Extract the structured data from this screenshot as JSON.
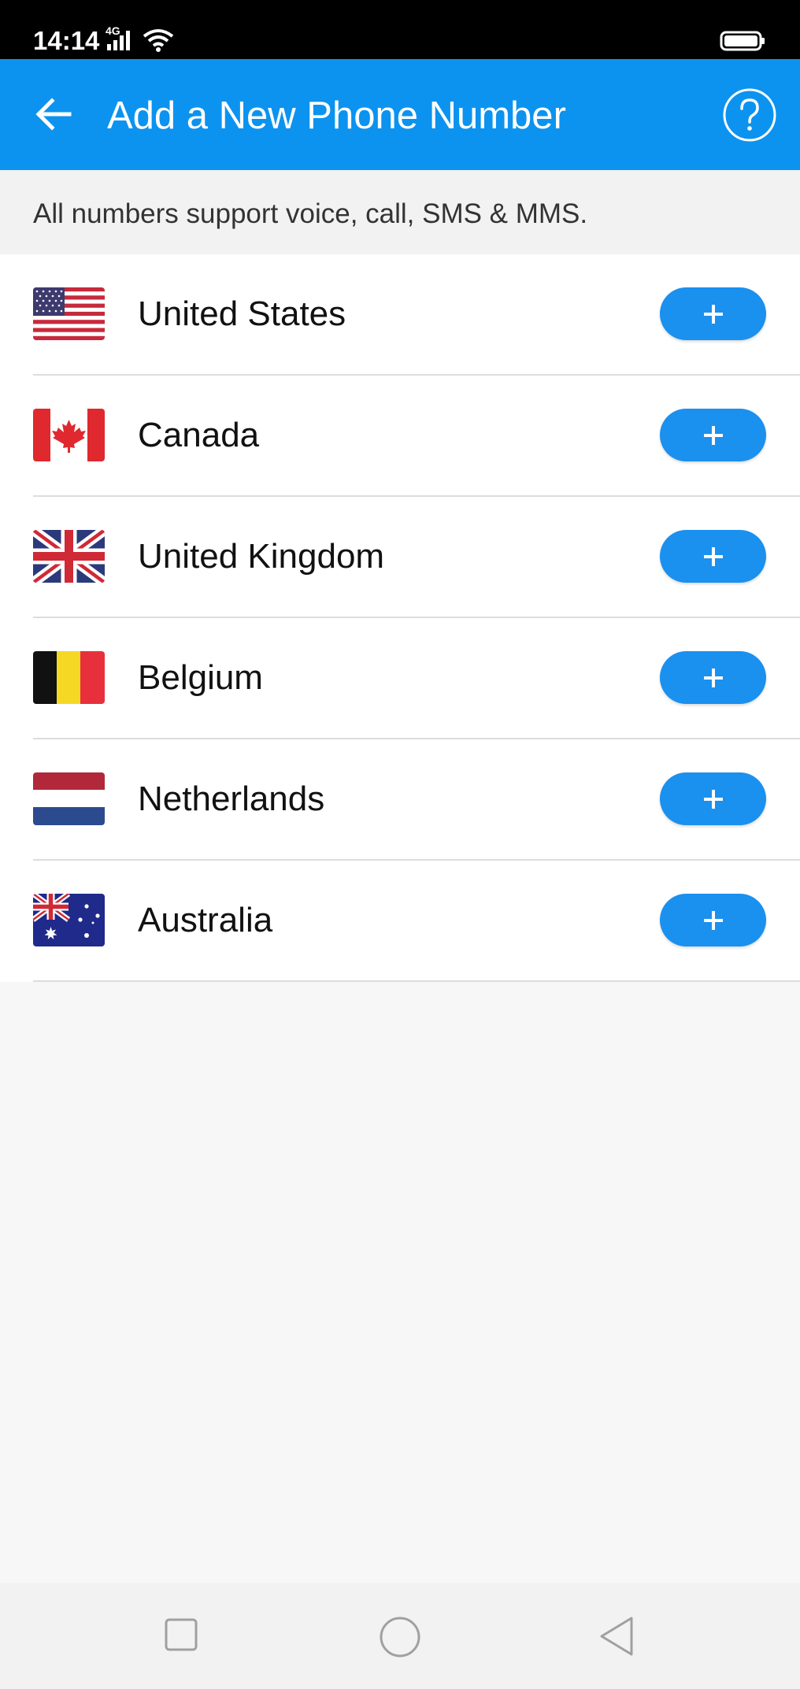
{
  "status_bar": {
    "time": "14:14",
    "network": "4G",
    "icons": [
      "signal-icon",
      "wifi-icon",
      "battery-icon"
    ]
  },
  "app_bar": {
    "title": "Add a New Phone Number",
    "back_icon": "arrow-left-icon",
    "help_icon": "question-circle-icon",
    "background_color": "#0c93ef"
  },
  "info_banner": {
    "text": "All numbers support voice, call, SMS & MMS."
  },
  "countries": [
    {
      "name": "United States",
      "flag_icon": "us-flag-icon",
      "action_icon": "plus-icon"
    },
    {
      "name": "Canada",
      "flag_icon": "canada-flag-icon",
      "action_icon": "plus-icon"
    },
    {
      "name": "United Kingdom",
      "flag_icon": "uk-flag-icon",
      "action_icon": "plus-icon"
    },
    {
      "name": "Belgium",
      "flag_icon": "belgium-flag-icon",
      "action_icon": "plus-icon"
    },
    {
      "name": "Netherlands",
      "flag_icon": "netherlands-flag-icon",
      "action_icon": "plus-icon"
    },
    {
      "name": "Australia",
      "flag_icon": "australia-flag-icon",
      "action_icon": "plus-icon"
    }
  ],
  "colors": {
    "accent": "#0c93ef",
    "add_button": "#1a90ef",
    "banner_background": "#f2f2f2"
  },
  "nav_bar": {
    "icons": [
      "recent-apps-icon",
      "home-icon",
      "back-triangle-icon"
    ]
  }
}
